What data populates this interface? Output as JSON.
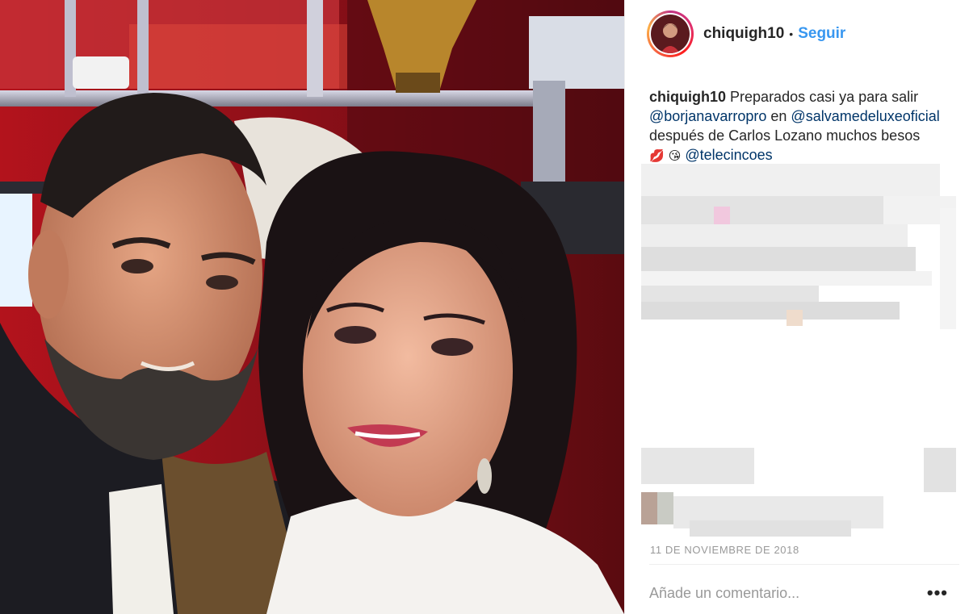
{
  "post": {
    "username": "chiquigh10",
    "separator": "•",
    "follow_label": "Seguir",
    "caption": {
      "username": "chiquigh10",
      "text_1": "Preparados casi ya para salir",
      "mention_1": "@borjanavarropro",
      "text_2": "en",
      "mention_2": "@salvamedeluxeoficial",
      "text_3": "después de Carlos Lozano muchos besos",
      "emoji_1": "💋",
      "emoji_2": "😘",
      "mention_3": "@telecincoes"
    },
    "date": "11 DE NOVIEMBRE DE 2018",
    "comment_placeholder": "Añade un comentario...",
    "more_label": "•••"
  },
  "icons": {
    "avatar": "profile-avatar",
    "more": "more-options-icon"
  },
  "colors": {
    "link_blue": "#3897f0",
    "mention_blue": "#003569",
    "meta_gray": "#999999"
  }
}
